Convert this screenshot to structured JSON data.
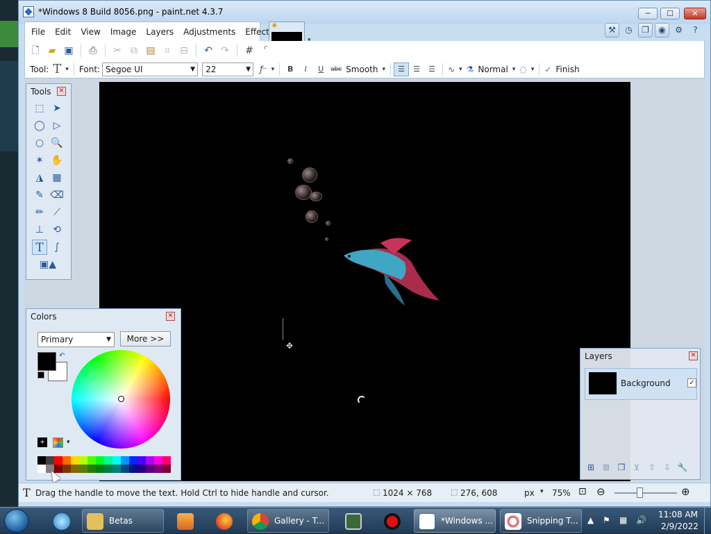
{
  "window": {
    "title": "*Windows 8 Build 8056.png - paint.net 4.3.7",
    "minimize": "─",
    "maximize": "☐",
    "close": "✕"
  },
  "menu": [
    "File",
    "Edit",
    "View",
    "Image",
    "Layers",
    "Adjustments",
    "Effects"
  ],
  "toolbar2": {
    "tool_label": "Tool:",
    "font_label": "Font:",
    "font_value": "Segoe UI",
    "size_value": "22",
    "antialias_value": "Smooth",
    "blend_value": "Normal",
    "finish_label": "Finish",
    "bold": "B",
    "italic": "I",
    "underline": "U",
    "strike": "abc"
  },
  "tools_panel": {
    "title": "Tools"
  },
  "colors_panel": {
    "title": "Colors",
    "mode": "Primary",
    "more_label": "More >>",
    "primary_color": "#000000",
    "secondary_color": "#ffffff",
    "palette_row1": [
      "#000000",
      "#404040",
      "#ff0000",
      "#ff6a00",
      "#ffd800",
      "#b6ff00",
      "#4cff00",
      "#00ff21",
      "#00ff90",
      "#00ffff",
      "#0094ff",
      "#0026ff",
      "#4800ff",
      "#b200ff",
      "#ff00dc",
      "#ff006e"
    ],
    "palette_row2": [
      "#ffffff",
      "#808080",
      "#7f0000",
      "#7f3300",
      "#7f6a00",
      "#5b7f00",
      "#267f00",
      "#007f0e",
      "#007f46",
      "#007f7f",
      "#004a7f",
      "#00137f",
      "#21007f",
      "#57007f",
      "#7f006e",
      "#7f0037"
    ]
  },
  "layers_panel": {
    "title": "Layers",
    "layer_name": "Background",
    "layer_visible": "✓"
  },
  "status": {
    "hint": "Drag the handle to move the text. Hold Ctrl to hide handle and cursor.",
    "image_size": "1024 × 768",
    "cursor_pos": "276, 608",
    "units": "px",
    "zoom": "75%",
    "zoom_slider_fraction": 0.4
  },
  "taskbar": {
    "apps": [
      {
        "name": "Betas",
        "icon": "folder-icon"
      },
      {
        "name": "Gallery - T...",
        "icon": "chrome-icon"
      },
      {
        "name": "*Windows ...",
        "icon": "paintnet-icon"
      },
      {
        "name": "Snipping T...",
        "icon": "snipping-tool-icon"
      }
    ],
    "time": "11:08 AM",
    "date": "2/9/2022"
  },
  "colors": {
    "accent": "#2e6fc0",
    "canvas": "#000000",
    "panel": "#dfe9f4"
  }
}
